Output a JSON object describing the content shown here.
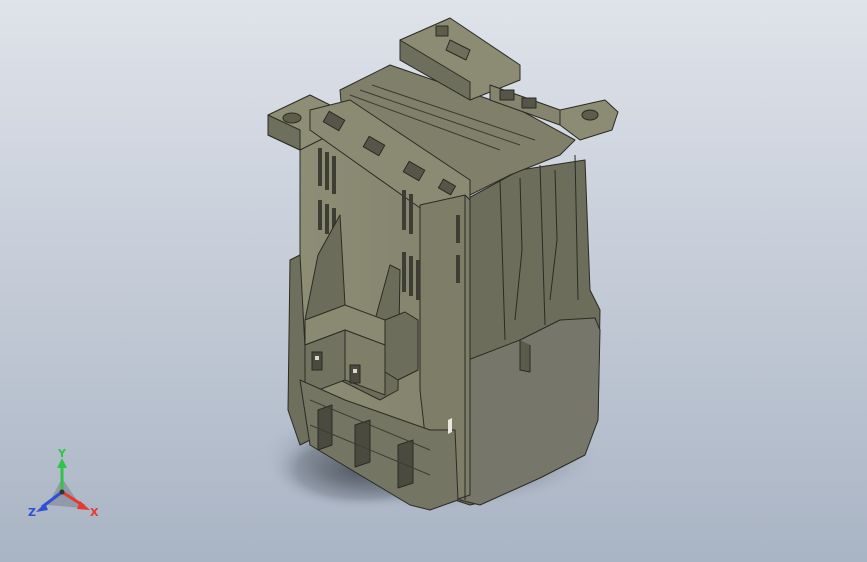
{
  "viewport": {
    "background_top": "#dfe3ea",
    "background_bottom": "#a9b4c4",
    "model_color": "#8a8a73",
    "edge_color": "#2b2b24",
    "shadow_color": "#5f6672"
  },
  "triad": {
    "x_label": "X",
    "y_label": "Y",
    "z_label": "Z",
    "x_color": "#e53a2f",
    "y_color": "#34c34a",
    "z_color": "#2f4fd6"
  }
}
